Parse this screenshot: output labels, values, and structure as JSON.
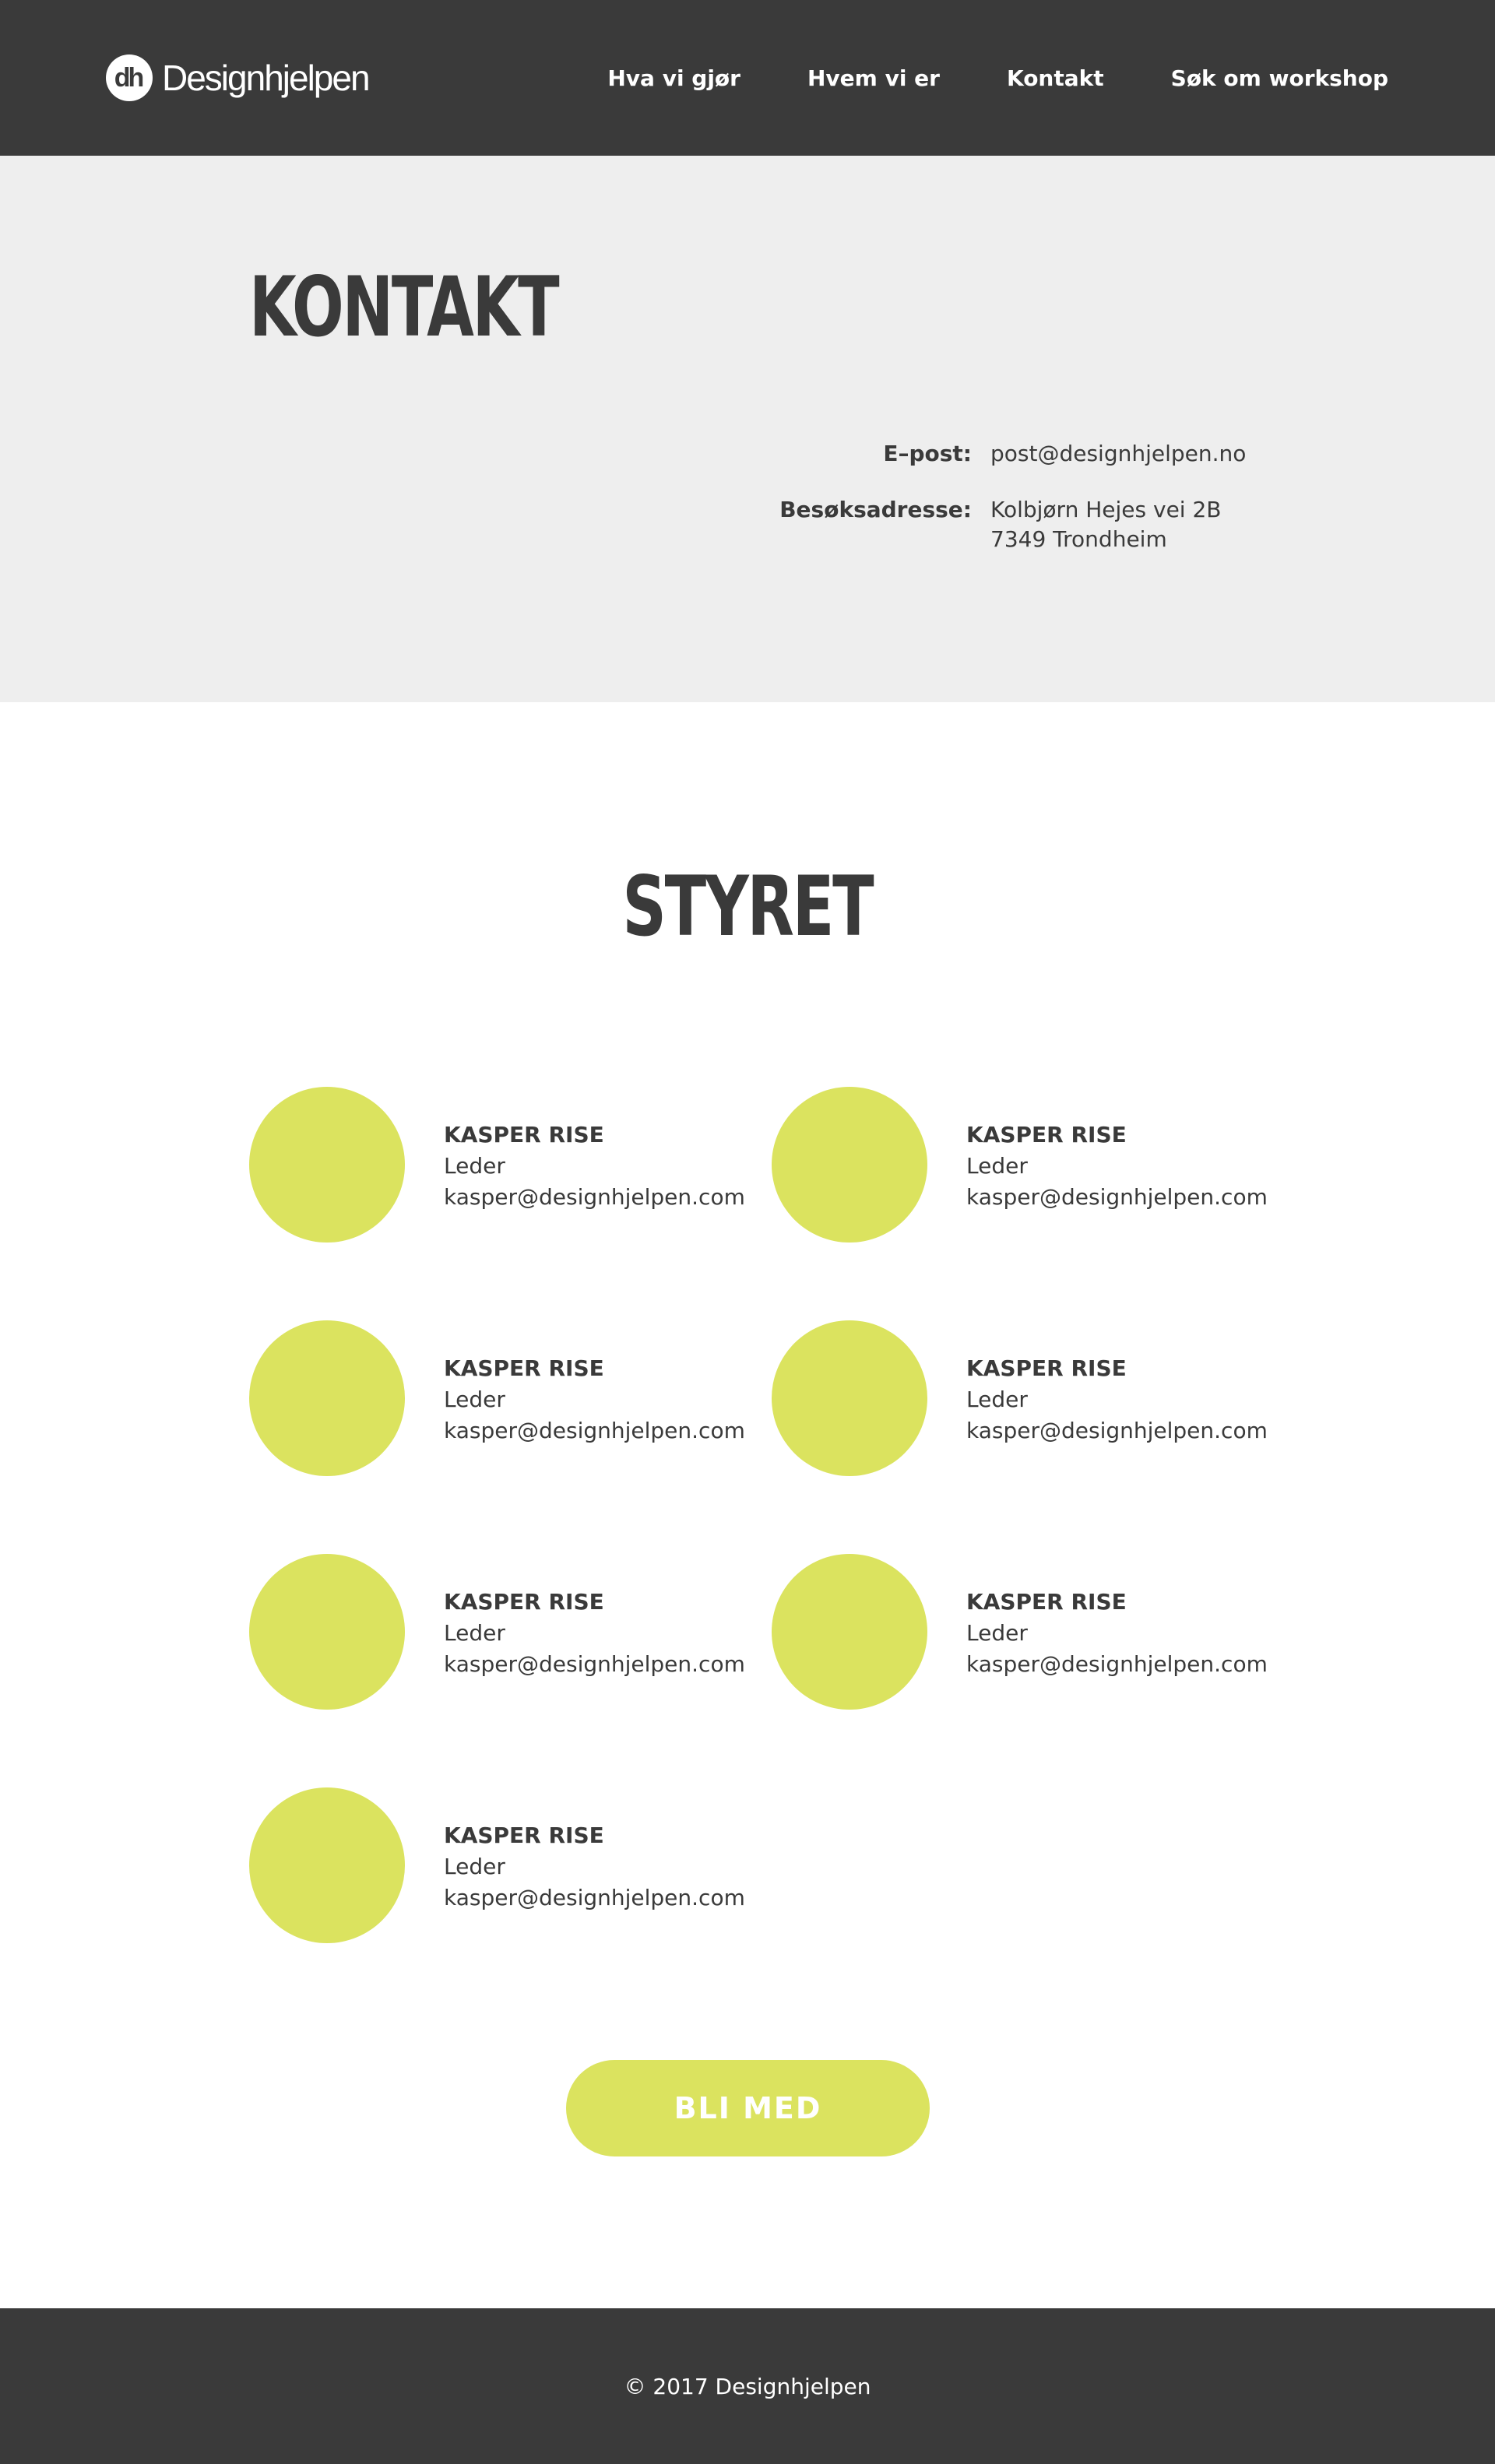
{
  "header": {
    "logo_mark": "dh",
    "logo_text": "Designhjelpen",
    "nav": [
      {
        "label": "Hva vi gjør"
      },
      {
        "label": "Hvem vi er"
      },
      {
        "label": "Kontakt"
      },
      {
        "label": "Søk om workshop"
      }
    ]
  },
  "contact": {
    "title": "KONTAKT",
    "email_label": "E–post:",
    "email": "post@designhjelpen.no",
    "address_label": "Besøksadresse:",
    "address_line1": "Kolbjørn Hejes vei 2B",
    "address_line2": "7349 Trondheim"
  },
  "board": {
    "title": "STYRET",
    "members": [
      {
        "name": "KASPER RISE",
        "role": "Leder",
        "email": "kasper@designhjelpen.com"
      },
      {
        "name": "KASPER RISE",
        "role": "Leder",
        "email": "kasper@designhjelpen.com"
      },
      {
        "name": "KASPER RISE",
        "role": "Leder",
        "email": "kasper@designhjelpen.com"
      },
      {
        "name": "KASPER RISE",
        "role": "Leder",
        "email": "kasper@designhjelpen.com"
      },
      {
        "name": "KASPER RISE",
        "role": "Leder",
        "email": "kasper@designhjelpen.com"
      },
      {
        "name": "KASPER RISE",
        "role": "Leder",
        "email": "kasper@designhjelpen.com"
      },
      {
        "name": "KASPER RISE",
        "role": "Leder",
        "email": "kasper@designhjelpen.com"
      }
    ],
    "avatar_color": "#dbe35f"
  },
  "cta": {
    "label": "BLI MED"
  },
  "footer": {
    "copyright": "© 2017 Designhjelpen"
  },
  "colors": {
    "dark": "#3a3a3a",
    "light_bg": "#eeeeee",
    "accent": "#dbe35f"
  }
}
